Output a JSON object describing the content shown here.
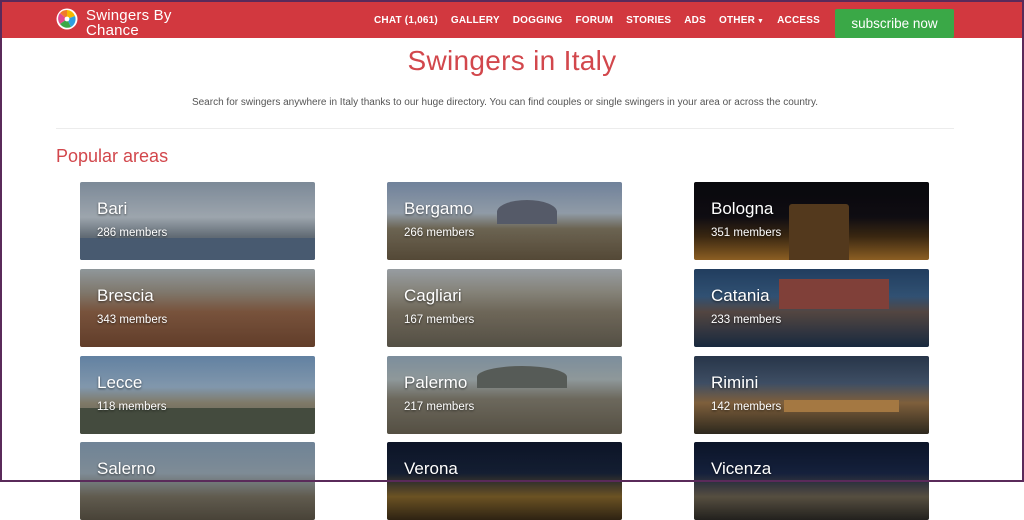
{
  "brand": {
    "name": "Swingers By Chance"
  },
  "nav": {
    "items": [
      "CHAT (1,061)",
      "GALLERY",
      "DOGGING",
      "FORUM",
      "STORIES",
      "ADS",
      "OTHER",
      "ACCESS"
    ],
    "subscribe_label": "subscribe now"
  },
  "page": {
    "title": "Swingers in Italy",
    "intro": "Search for swingers anywhere in Italy thanks to our huge directory. You can find couples or single swingers in your area or across the country.",
    "section_title": "Popular areas"
  },
  "cities": [
    {
      "name": "Bari",
      "members": "286 members"
    },
    {
      "name": "Bergamo",
      "members": "266 members"
    },
    {
      "name": "Bologna",
      "members": "351 members"
    },
    {
      "name": "Brescia",
      "members": "343 members"
    },
    {
      "name": "Cagliari",
      "members": "167 members"
    },
    {
      "name": "Catania",
      "members": "233 members"
    },
    {
      "name": "Lecce",
      "members": "118 members"
    },
    {
      "name": "Palermo",
      "members": "217 members"
    },
    {
      "name": "Rimini",
      "members": "142 members"
    },
    {
      "name": "Salerno",
      "members": ""
    },
    {
      "name": "Verona",
      "members": ""
    },
    {
      "name": "Vicenza",
      "members": ""
    }
  ],
  "colors": {
    "brand_red": "#d2383f",
    "title_red": "#d2474c",
    "subscribe_green": "#3aa847",
    "frame_purple": "#5a2a5a"
  },
  "icons": {
    "logo": "pinwheel-logo-icon",
    "other_dropdown": "caret-down-icon"
  }
}
